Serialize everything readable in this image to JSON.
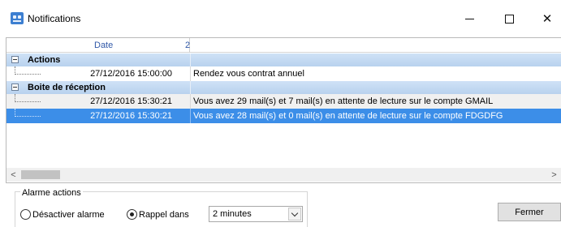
{
  "window": {
    "title": "Notifications",
    "controls": {
      "minimize": "minimize-icon",
      "maximize": "maximize-icon",
      "close": "close-icon"
    }
  },
  "grid": {
    "columns": {
      "date": "Date",
      "second": "2"
    },
    "groups": [
      {
        "name": "Actions",
        "rows": [
          {
            "date": "27/12/2016 15:00:00",
            "message": "Rendez vous contrat annuel",
            "selected": false
          }
        ]
      },
      {
        "name": "Boite de réception",
        "rows": [
          {
            "date": "27/12/2016 15:30:21",
            "message": "Vous avez 29 mail(s) et 7 mail(s) en attente de lecture sur le compte GMAIL",
            "selected": false
          },
          {
            "date": "27/12/2016 15:30:21",
            "message": "Vous avez 28 mail(s) et 0 mail(s) en attente de lecture sur le compte FDGDFG",
            "selected": true
          }
        ]
      }
    ]
  },
  "alarm": {
    "group_label": "Alarme actions",
    "option_disable": "Désactiver alarme",
    "option_remind": "Rappel dans",
    "selected_option": "Rappel dans",
    "reminder_value": "2 minutes"
  },
  "buttons": {
    "close_label": "Fermer"
  },
  "colors": {
    "group_header": "#c3d9f1",
    "selection": "#3c8ee8"
  }
}
